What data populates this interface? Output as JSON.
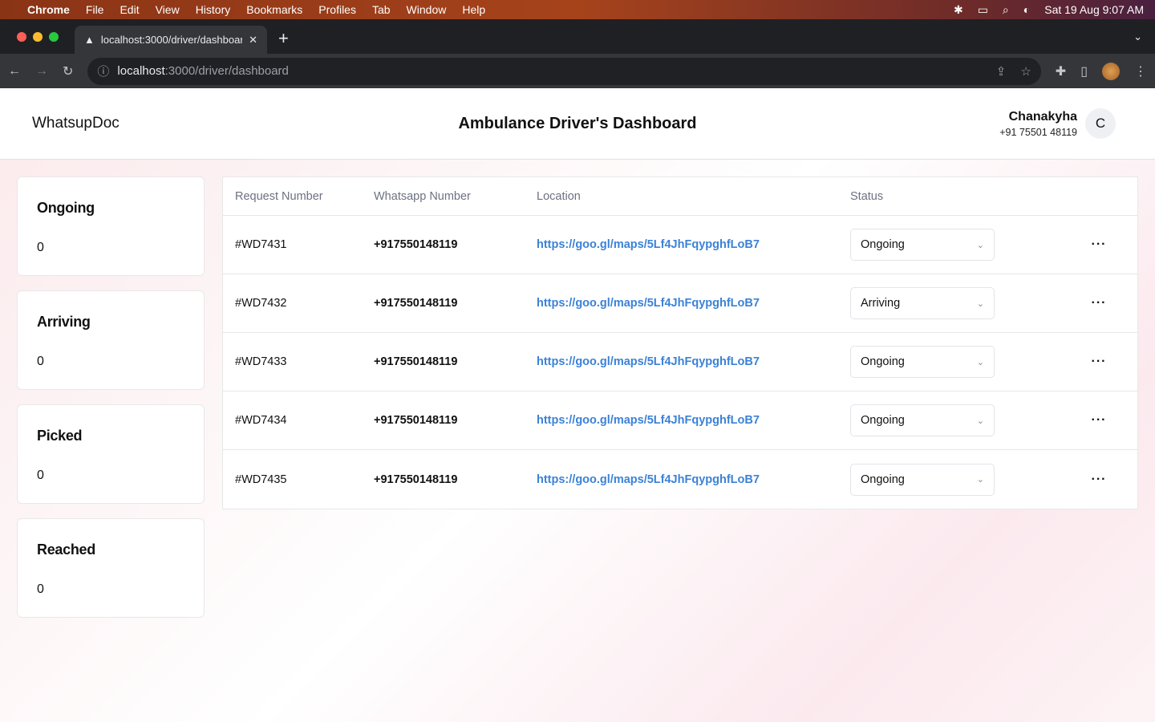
{
  "menubar": {
    "app": "Chrome",
    "items": [
      "File",
      "Edit",
      "View",
      "History",
      "Bookmarks",
      "Profiles",
      "Tab",
      "Window",
      "Help"
    ],
    "datetime": "Sat 19 Aug  9:07 AM"
  },
  "browser": {
    "tab_title": "localhost:3000/driver/dashboard",
    "url_host": "localhost",
    "url_path": ":3000/driver/dashboard"
  },
  "header": {
    "brand": "WhatsupDoc",
    "title": "Ambulance Driver's Dashboard",
    "user_name": "Chanakyha",
    "user_phone": "+91 75501 48119",
    "avatar_initial": "C"
  },
  "cards": [
    {
      "label": "Ongoing",
      "value": "0"
    },
    {
      "label": "Arriving",
      "value": "0"
    },
    {
      "label": "Picked",
      "value": "0"
    },
    {
      "label": "Reached",
      "value": "0"
    }
  ],
  "table": {
    "headers": [
      "Request Number",
      "Whatsapp Number",
      "Location",
      "Status"
    ],
    "rows": [
      {
        "id": "#WD7431",
        "phone": "+917550148119",
        "location": "https://goo.gl/maps/5Lf4JhFqypghfLoB7",
        "status": "Ongoing"
      },
      {
        "id": "#WD7432",
        "phone": "+917550148119",
        "location": "https://goo.gl/maps/5Lf4JhFqypghfLoB7",
        "status": "Arriving"
      },
      {
        "id": "#WD7433",
        "phone": "+917550148119",
        "location": "https://goo.gl/maps/5Lf4JhFqypghfLoB7",
        "status": "Ongoing"
      },
      {
        "id": "#WD7434",
        "phone": "+917550148119",
        "location": "https://goo.gl/maps/5Lf4JhFqypghfLoB7",
        "status": "Ongoing"
      },
      {
        "id": "#WD7435",
        "phone": "+917550148119",
        "location": "https://goo.gl/maps/5Lf4JhFqypghfLoB7",
        "status": "Ongoing"
      }
    ]
  },
  "colors": {
    "link": "#3b82d6"
  }
}
